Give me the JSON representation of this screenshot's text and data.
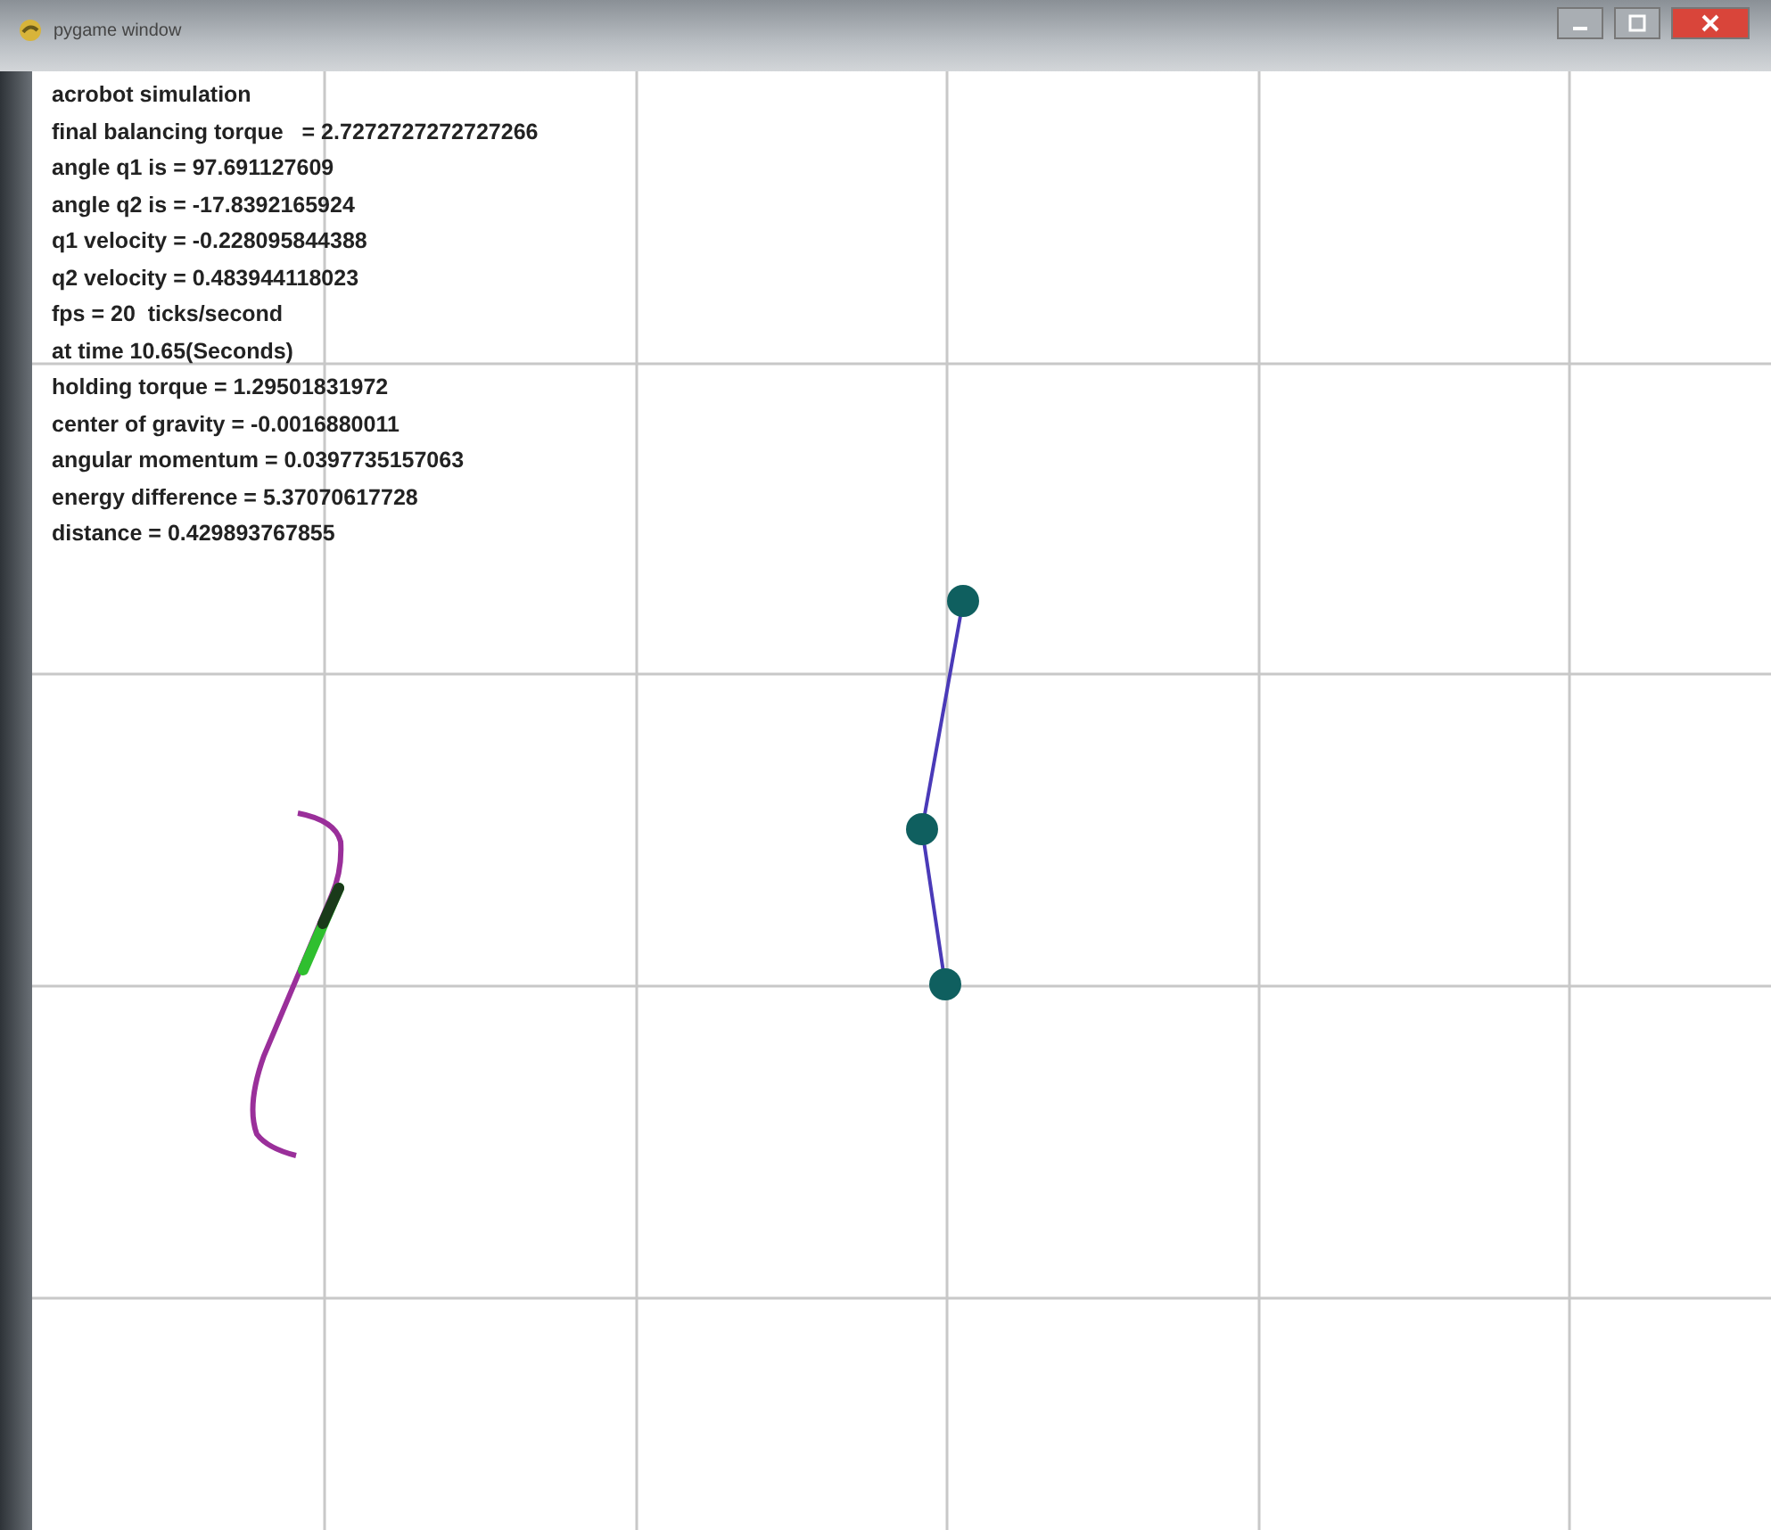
{
  "window": {
    "title": "pygame window"
  },
  "readouts": [
    "acrobot simulation",
    "final balancing torque   = 2.7272727272727266",
    "angle q1 is = 97.691127609",
    "angle q2 is = -17.8392165924",
    "q1 velocity = -0.228095844388",
    "q2 velocity = 0.483944118023",
    "fps = 20  ticks/second",
    "at time 10.65(Seconds)",
    "holding torque = 1.29501831972",
    "center of gravity = -0.0016880011",
    "angular momentum = 0.0397735157063",
    "energy difference = 5.37070617728",
    "distance = 0.429893767855"
  ]
}
